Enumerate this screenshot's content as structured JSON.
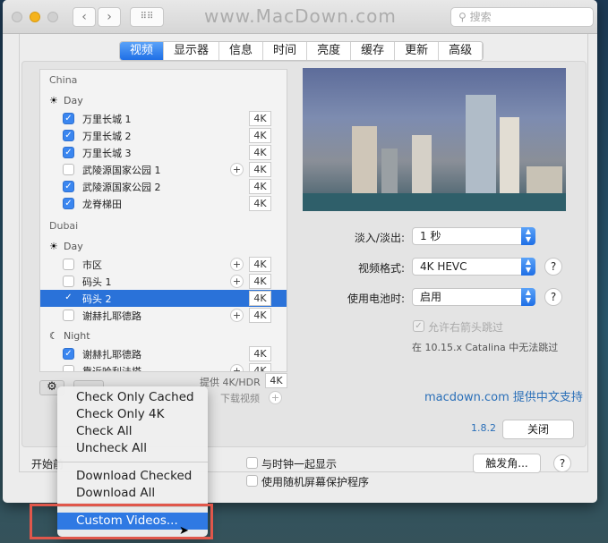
{
  "window": {
    "search_placeholder": "搜索",
    "watermark": "www.MacDown.com"
  },
  "tabs": [
    "视频",
    "显示器",
    "信息",
    "时间",
    "亮度",
    "缓存",
    "更新",
    "高级"
  ],
  "list": {
    "groups": [
      {
        "name": "China",
        "subgroups": [
          {
            "name": "Day",
            "icon": "sun-icon",
            "items": [
              {
                "label": "万里长城 1",
                "checked": true,
                "downloadable": false,
                "quality": "4K"
              },
              {
                "label": "万里长城 2",
                "checked": true,
                "downloadable": false,
                "quality": "4K"
              },
              {
                "label": "万里长城 3",
                "checked": true,
                "downloadable": false,
                "quality": "4K"
              },
              {
                "label": "武陵源国家公园 1",
                "checked": false,
                "downloadable": true,
                "quality": "4K"
              },
              {
                "label": "武陵源国家公园 2",
                "checked": true,
                "downloadable": false,
                "quality": "4K"
              },
              {
                "label": "龙脊梯田",
                "checked": true,
                "downloadable": false,
                "quality": "4K"
              }
            ]
          }
        ]
      },
      {
        "name": "Dubai",
        "subgroups": [
          {
            "name": "Day",
            "icon": "sun-icon",
            "items": [
              {
                "label": "市区",
                "checked": false,
                "downloadable": true,
                "quality": "4K"
              },
              {
                "label": "码头 1",
                "checked": false,
                "downloadable": true,
                "quality": "4K"
              },
              {
                "label": "码头 2",
                "checked": true,
                "downloadable": false,
                "quality": "4K",
                "selected": true
              },
              {
                "label": "谢赫扎耶德路",
                "checked": false,
                "downloadable": true,
                "quality": "4K"
              }
            ]
          },
          {
            "name": "Night",
            "icon": "moon-icon",
            "items": [
              {
                "label": "谢赫扎耶德路",
                "checked": true,
                "downloadable": false,
                "quality": "4K"
              },
              {
                "label": "靠近哈利法塔",
                "checked": false,
                "downloadable": true,
                "quality": "4K"
              }
            ]
          }
        ]
      }
    ],
    "legend_hdr": "提供 4K/HDR",
    "legend_hdr_badge": "4K",
    "legend_download": "下载视频"
  },
  "settings": {
    "fade_label": "淡入/淡出:",
    "fade_value": "1 秒",
    "format_label": "视频格式:",
    "format_value": "4K HEVC",
    "battery_label": "使用电池时:",
    "battery_value": "启用",
    "skip_label": "允许右箭头跳过",
    "skip_checked": true,
    "skip_note": "在 10.15.x Catalina 中无法跳过",
    "support_link": "macdown.com 提供中文支持",
    "version": "1.8.2",
    "close": "关闭"
  },
  "bottom": {
    "start_label": "开始前",
    "clock_label": "与时钟一起显示",
    "random_label": "使用随机屏幕保护程序",
    "hot_corners": "触发角...",
    "help": "?"
  },
  "menu": {
    "items": [
      "Check Only Cached",
      "Check Only 4K",
      "Check All",
      "Uncheck All",
      "Download Checked",
      "Download All",
      "Custom Videos..."
    ],
    "highlighted": "Custom Videos..."
  },
  "colors": {
    "accent": "#2f79e3",
    "highlight_box": "#e0574b",
    "link": "#2a6fb8"
  }
}
